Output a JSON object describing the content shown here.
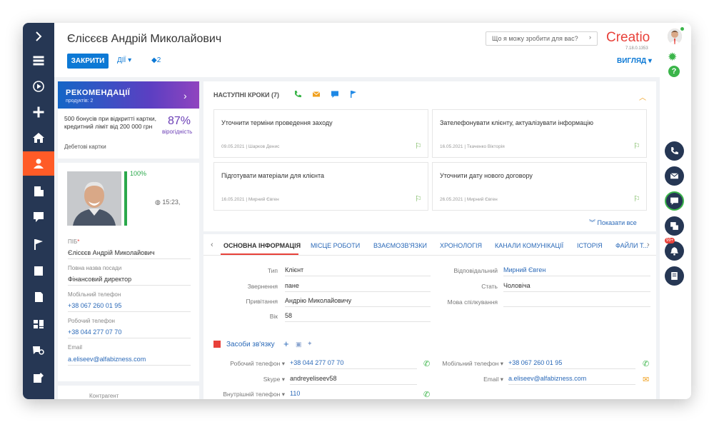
{
  "header": {
    "title": "Єлісєєв Андрій Миколайович",
    "close_label": "ЗАКРИТИ",
    "actions_label": "ДІЇ ▾",
    "tags_label": "2",
    "search_placeholder": "Що я можу зробити для вас?",
    "logo": "Creatio",
    "version": "7.18.0.1353",
    "view_label": "ВИГЛЯД ▾"
  },
  "recommendations": {
    "title": "РЕКОМЕНДАЦІЇ",
    "subtitle": "продуктів: 2",
    "text": "500 бонусів при відкритті картки, кредитний ліміт від 200 000 грн",
    "percent": "87%",
    "percent_label": "вірогідність",
    "footer": "Дебетові картки"
  },
  "profile": {
    "completeness": "100%",
    "time": "15:23,",
    "fields": [
      {
        "label": "ПІБ",
        "required": "*",
        "value": "Єлісєєв Андрій Миколайович",
        "link": false
      },
      {
        "label": "Повна назва посади",
        "value": "Фінансовий директор",
        "link": false
      },
      {
        "label": "Мобільний телефон",
        "value": "+38 067 260 01 95",
        "link": true
      },
      {
        "label": "Робочий телефон",
        "value": "+38 044 277 07 70",
        "link": true
      },
      {
        "label": "Email",
        "value": "a.eliseev@alfabizness.com",
        "link": true
      }
    ],
    "next_label": "Контрагент"
  },
  "next_steps": {
    "title": "НАСТУПНІ КРОКИ (7)",
    "tasks": [
      {
        "title": "Уточнити терміни проведення заходу",
        "date": "09.05.2021",
        "owner": "Шарков Денис"
      },
      {
        "title": "Зателефонувати клієнту, актуалізувати інформацію",
        "date": "16.05.2021",
        "owner": "Ткаченко Вікторія"
      },
      {
        "title": "Підготувати матеріали для клієнта",
        "date": "16.05.2021",
        "owner": "Мирний Євген"
      },
      {
        "title": "Уточнити дату нового договору",
        "date": "26.05.2021",
        "owner": "Мирний Євген"
      }
    ],
    "show_all": "Показати все"
  },
  "tabs": [
    "ОСНОВНА ІНФОРМАЦІЯ",
    "МІСЦЕ РОБОТИ",
    "ВЗАЄМОЗВ'ЯЗКИ",
    "ХРОНОЛОГІЯ",
    "КАНАЛИ КОМУНІКАЦІЇ",
    "ІСТОРІЯ",
    "ФАЙЛИ Т..."
  ],
  "main_info": {
    "type_label": "Тип",
    "type_value": "Клієнт",
    "address_label": "Звернення",
    "address_value": "пане",
    "greeting_label": "Привітання",
    "greeting_value": "Андрію Миколайовичу",
    "age_label": "Вік",
    "age_value": "58",
    "owner_label": "Відповідальний",
    "owner_value": "Мирний Євген",
    "gender_label": "Стать",
    "gender_value": "Чоловіча",
    "lang_label": "Мова спілкування",
    "lang_value": ""
  },
  "contacts": {
    "section_title": "Засоби зв'язку",
    "work_phone_label": "Робочий телефон ▾",
    "work_phone_value": "+38 044 277 07 70",
    "skype_label": "Skype ▾",
    "skype_value": "andreyeliseev58",
    "internal_label": "Внутрішній телефон ▾",
    "internal_value": "110",
    "mobile_label": "Мобільний телефон ▾",
    "mobile_value": "+38 067 260 01 95",
    "email_label": "Email ▾",
    "email_value": "a.eliseev@alfabizness.com"
  },
  "right_panel": {
    "notifications_badge": "99+"
  }
}
